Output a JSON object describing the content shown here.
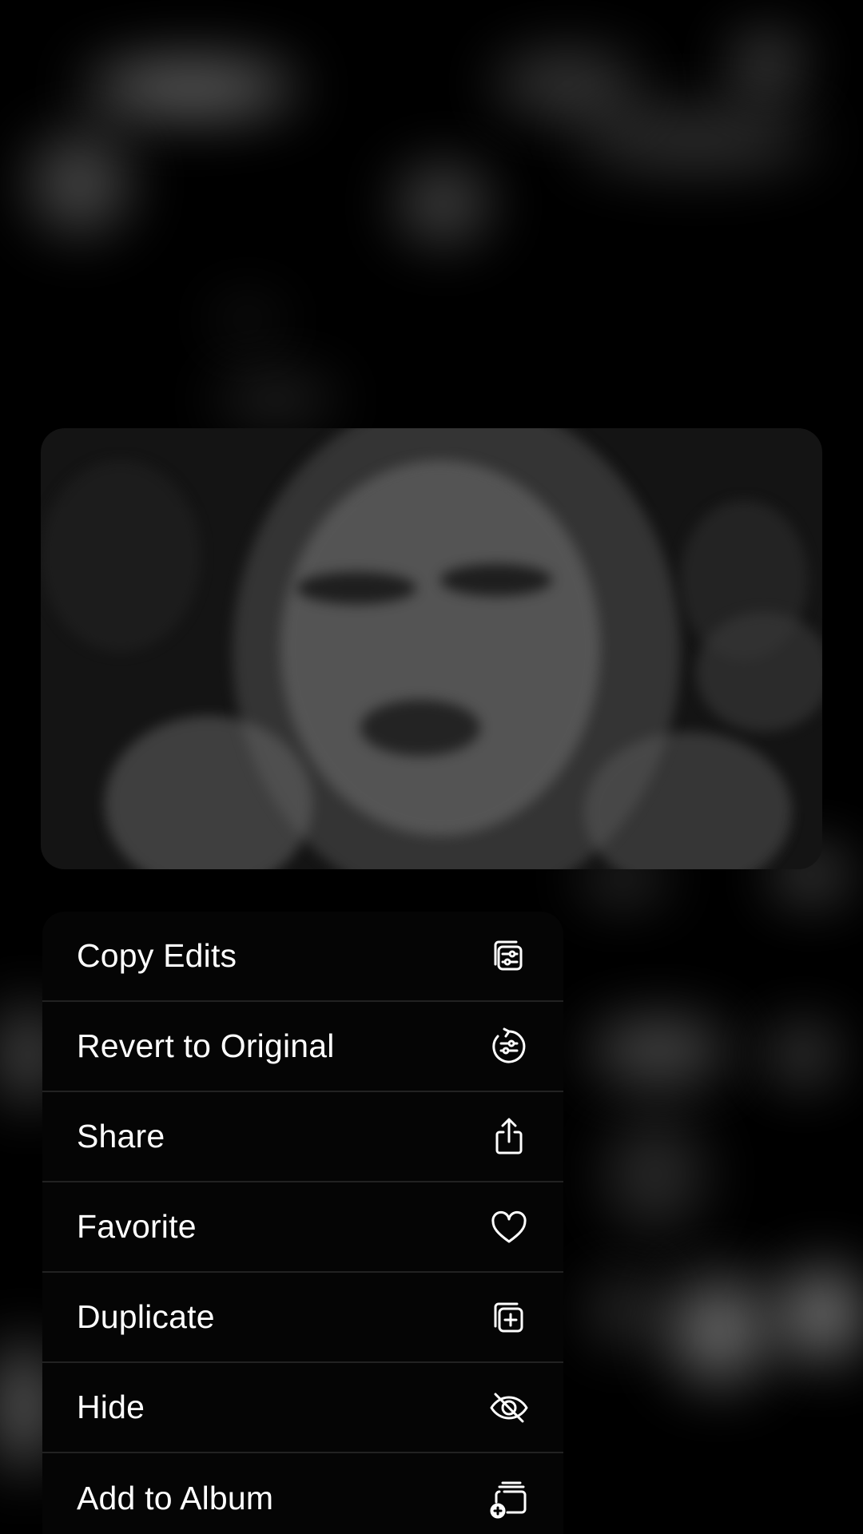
{
  "context_menu": {
    "items": [
      {
        "label": "Copy Edits",
        "icon": "copy-edits-icon"
      },
      {
        "label": "Revert to Original",
        "icon": "revert-icon"
      },
      {
        "label": "Share",
        "icon": "share-icon"
      },
      {
        "label": "Favorite",
        "icon": "heart-icon"
      },
      {
        "label": "Duplicate",
        "icon": "duplicate-icon"
      },
      {
        "label": "Hide",
        "icon": "eye-slash-icon"
      },
      {
        "label": "Add to Album",
        "icon": "add-to-album-icon"
      }
    ]
  },
  "colors": {
    "background": "#000000",
    "menu_background": "#050505",
    "text": "#ffffff",
    "separator": "#222222"
  }
}
